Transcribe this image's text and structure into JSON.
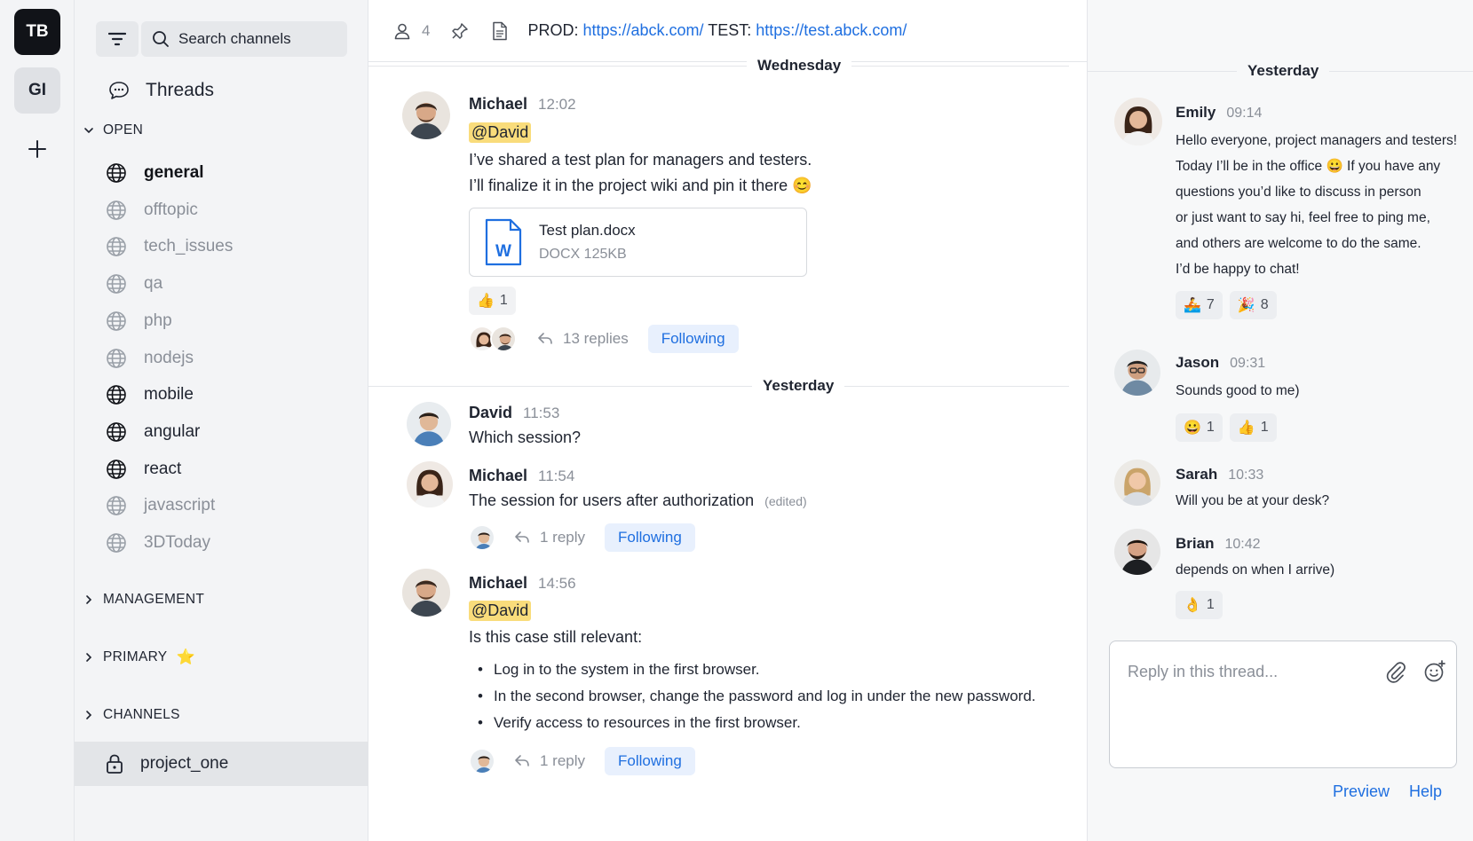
{
  "colors": {
    "accent": "#1f6fe0",
    "mention_bg": "#f9dc7b",
    "follow_bg": "#e8f0fd",
    "active_row": "#e3e5e8"
  },
  "workspaces": [
    {
      "label": "TB",
      "icon": "workspace-tb"
    },
    {
      "label": "GI",
      "icon": "workspace-gi"
    }
  ],
  "sidebar": {
    "search_placeholder": "Search channels",
    "threads_label": "Threads",
    "open_section": "OPEN",
    "channels_open": [
      {
        "name": "general",
        "style": "active-bold",
        "icon": "globe-icon"
      },
      {
        "name": "offtopic",
        "style": "muted",
        "icon": "globe-icon"
      },
      {
        "name": "tech_issues",
        "style": "muted",
        "icon": "globe-icon"
      },
      {
        "name": "qa",
        "style": "muted",
        "icon": "globe-icon"
      },
      {
        "name": "php",
        "style": "muted",
        "icon": "globe-icon"
      },
      {
        "name": "nodejs",
        "style": "muted",
        "icon": "globe-icon"
      },
      {
        "name": "mobile",
        "style": "bold",
        "icon": "globe-icon"
      },
      {
        "name": "angular",
        "style": "bold",
        "icon": "globe-icon"
      },
      {
        "name": "react",
        "style": "bold",
        "icon": "globe-icon"
      },
      {
        "name": "javascript",
        "style": "muted",
        "icon": "globe-icon"
      },
      {
        "name": "3DToday",
        "style": "muted",
        "icon": "globe-icon"
      }
    ],
    "management_section": "MANAGEMENT",
    "primary_section": "PRIMARY",
    "primary_emoji": "⭐",
    "channels_section": "CHANNELS",
    "private_channel": "project_one"
  },
  "header": {
    "members_count": "4",
    "prod_label": "PROD:",
    "prod_url": "https://abck.com/",
    "test_label": "TEST:",
    "test_url": "https://test.abck.com/"
  },
  "main": {
    "day1": "Wednesday",
    "day2": "Yesterday",
    "messages": [
      {
        "author": "Michael",
        "time": "12:02",
        "mention": "@David",
        "line1": "I’ve shared a test plan for managers and testers.",
        "line2": "I’ll finalize it in the project wiki and pin it there 😊",
        "attachment": {
          "name": "Test plan.docx",
          "meta": "DOCX 125KB"
        },
        "reaction": {
          "emoji": "👍",
          "count": "1"
        },
        "replies": "13 replies",
        "follow": "Following"
      },
      {
        "author": "David",
        "time": "11:53",
        "text": "Which session?"
      },
      {
        "author": "Michael",
        "time": "11:54",
        "text": "The session for users after authorization",
        "edited": "(edited)",
        "replies": "1 reply",
        "follow": "Following"
      },
      {
        "author": "Michael",
        "time": "14:56",
        "mention": "@David",
        "text": "Is this case still relevant:",
        "bullets": [
          "Log in to the system in the first browser.",
          "In the second browser, change the password and log in under the new password.",
          "Verify access to resources in the first browser."
        ],
        "replies": "1 reply",
        "follow": "Following"
      }
    ]
  },
  "thread": {
    "day": "Yesterday",
    "messages": [
      {
        "author": "Emily",
        "time": "09:14",
        "lines": [
          "Hello everyone, project managers and testers!",
          "Today I’ll be in the office 😀 If you have any",
          "questions you’d like to discuss in person",
          "or just want to say hi, feel free to ping me,",
          "and others are welcome to do the same.",
          "I’d be happy to chat!"
        ],
        "reactions": [
          {
            "emoji": "🚣",
            "count": "7"
          },
          {
            "emoji": "🎉",
            "count": "8"
          }
        ]
      },
      {
        "author": "Jason",
        "time": "09:31",
        "text": "Sounds good to me)",
        "reactions": [
          {
            "emoji": "😀",
            "count": "1"
          },
          {
            "emoji": "👍",
            "count": "1"
          }
        ]
      },
      {
        "author": "Sarah",
        "time": "10:33",
        "text": "Will you be at your desk?"
      },
      {
        "author": "Brian",
        "time": "10:42",
        "text": "depends on when I arrive)",
        "reactions": [
          {
            "emoji": "👌",
            "count": "1"
          }
        ]
      }
    ],
    "reply_placeholder": "Reply in this thread...",
    "preview": "Preview",
    "help": "Help"
  }
}
